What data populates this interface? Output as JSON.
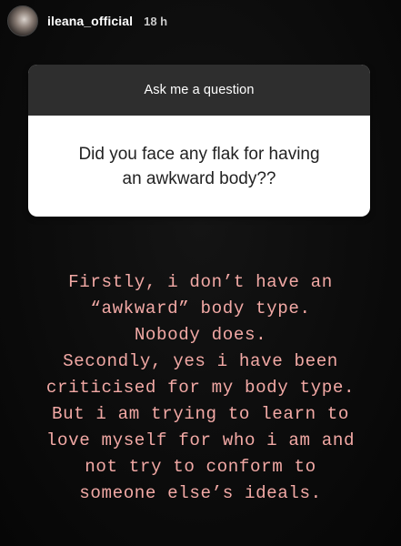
{
  "header": {
    "username": "ileana_official",
    "time": "18 h"
  },
  "question_sticker": {
    "prompt": "Ask me a question",
    "question_lines": [
      "Did you face any flak for having",
      "an awkward body??"
    ]
  },
  "answer": {
    "lines": [
      "Firstly, i don’t have an",
      "“awkward” body type.",
      "Nobody does.",
      "Secondly, yes i have been",
      "criticised for my body type.",
      "But i am trying to learn to",
      "love myself for who i am and",
      "not try to conform to",
      "someone else’s ideals."
    ],
    "color": "#f2a9a5"
  }
}
